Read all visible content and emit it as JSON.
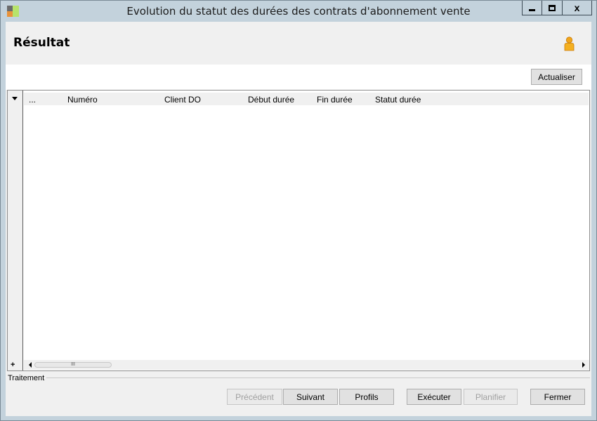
{
  "window": {
    "title": "Evolution du statut des durées des contrats d'abonnement vente",
    "min_icon": "minimize-icon",
    "max_icon": "maximize-icon",
    "close_icon": "close-icon",
    "close_glyph": "x"
  },
  "header": {
    "title": "Résultat",
    "user_icon": "user-icon"
  },
  "toolbar": {
    "refresh_label": "Actualiser"
  },
  "grid": {
    "expander_icon": "chevron-down-icon",
    "columns": [
      "...",
      "Numéro",
      "Client DO",
      "Début durée",
      "Fin durée",
      "Statut durée"
    ],
    "rows": [],
    "add_glyph": "+",
    "thumb_glyph": "III"
  },
  "treatment": {
    "label": "Traitement",
    "buttons": {
      "previous": "Précédent",
      "next": "Suivant",
      "profiles": "Profils",
      "execute": "Exécuter",
      "plan": "Planifier",
      "close": "Fermer"
    }
  }
}
